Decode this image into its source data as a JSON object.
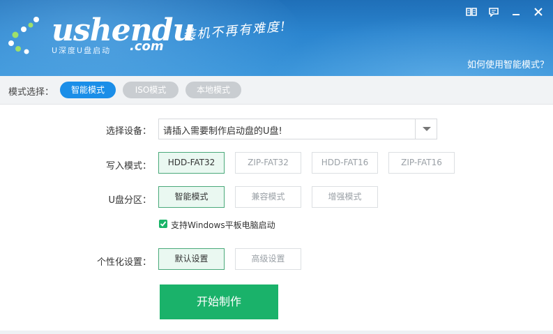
{
  "header": {
    "logo_text": "ushendu",
    "logo_sub": "U深度U盘启动",
    "logo_com": ".com",
    "slogan": "装机不再有难度!",
    "help_link": "如何使用智能模式？"
  },
  "modebar": {
    "label": "模式选择：",
    "modes": [
      {
        "label": "智能模式",
        "active": true
      },
      {
        "label": "ISO模式",
        "active": false
      },
      {
        "label": "本地模式",
        "active": false
      }
    ]
  },
  "form": {
    "device_label": "选择设备：",
    "device_value": "请插入需要制作启动盘的U盘!",
    "write_label": "写入模式：",
    "write_options": [
      "HDD-FAT32",
      "ZIP-FAT32",
      "HDD-FAT16",
      "ZIP-FAT16"
    ],
    "partition_label": "U盘分区：",
    "partition_options": [
      "智能模式",
      "兼容模式",
      "增强模式"
    ],
    "windows_tablet_label": "支持Windows平板电脑启动",
    "windows_tablet_checked": true,
    "personal_label": "个性化设置：",
    "personal_options": [
      "默认设置",
      "高级设置"
    ],
    "start_button": "开始制作"
  },
  "colors": {
    "header_blue": "#2b85cf",
    "active_pill": "#1b8ee8",
    "green": "#1ab26a"
  }
}
